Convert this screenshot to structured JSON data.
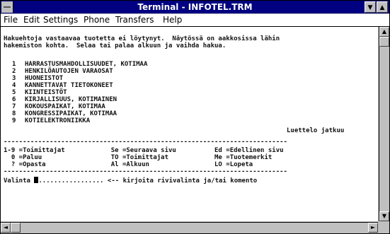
{
  "window": {
    "title": "Terminal - INFOTEL.TRM",
    "minimize_glyph": "▼",
    "maximize_glyph": "▲"
  },
  "menubar": {
    "items": [
      "File",
      "Edit",
      "Settings",
      "Phone",
      "Transfers",
      "Help"
    ]
  },
  "terminal": {
    "intro": [
      "Hakuehtoja vastaavaa tuotetta ei löytynyt.  Näytössä on aakkosissa lähin",
      "hakemiston kohta.  Selaa tai palaa alkuun ja vaihda hakua."
    ],
    "results": [
      {
        "num": "1",
        "text": "HARRASTUSMAHDOLLISUUDET, KOTIMAA"
      },
      {
        "num": "2",
        "text": "HENKILÖAUTOJEN VARAOSAT"
      },
      {
        "num": "3",
        "text": "HUONEISTOT"
      },
      {
        "num": "4",
        "text": "KANNETTAVAT TIETOKONEET"
      },
      {
        "num": "5",
        "text": "KIINTEISTÖT"
      },
      {
        "num": "6",
        "text": "KIRJALLISUUS, KOTIMAINEN"
      },
      {
        "num": "7",
        "text": "KOKOUSPAIKAT, KOTIMAA"
      },
      {
        "num": "8",
        "text": "KONGRESSIPAIKAT, KOTIMAA"
      },
      {
        "num": "9",
        "text": "KOTIELEKTRONIIKKA"
      }
    ],
    "continues": "Luettelo jatkuu",
    "separator": "--------------------------------------------------------------------------",
    "commands": [
      "1-9 =Toimittajat            Se =Seuraava sivu          Ed =Edellinen sivu",
      "  0 =Paluu                  TO =Toimittajat            Me =Tuotemerkit",
      "  ? =Opasta                 Al =Alkuun                 LO =Lopeta"
    ],
    "prompt_label": "Valinta ",
    "prompt_dots": ".................",
    "prompt_hint": " <-- kirjoita rivivalinta ja/tai komento"
  },
  "scroll": {
    "up_glyph": "▲",
    "down_glyph": "▼",
    "left_glyph": "◄",
    "right_glyph": "►"
  }
}
